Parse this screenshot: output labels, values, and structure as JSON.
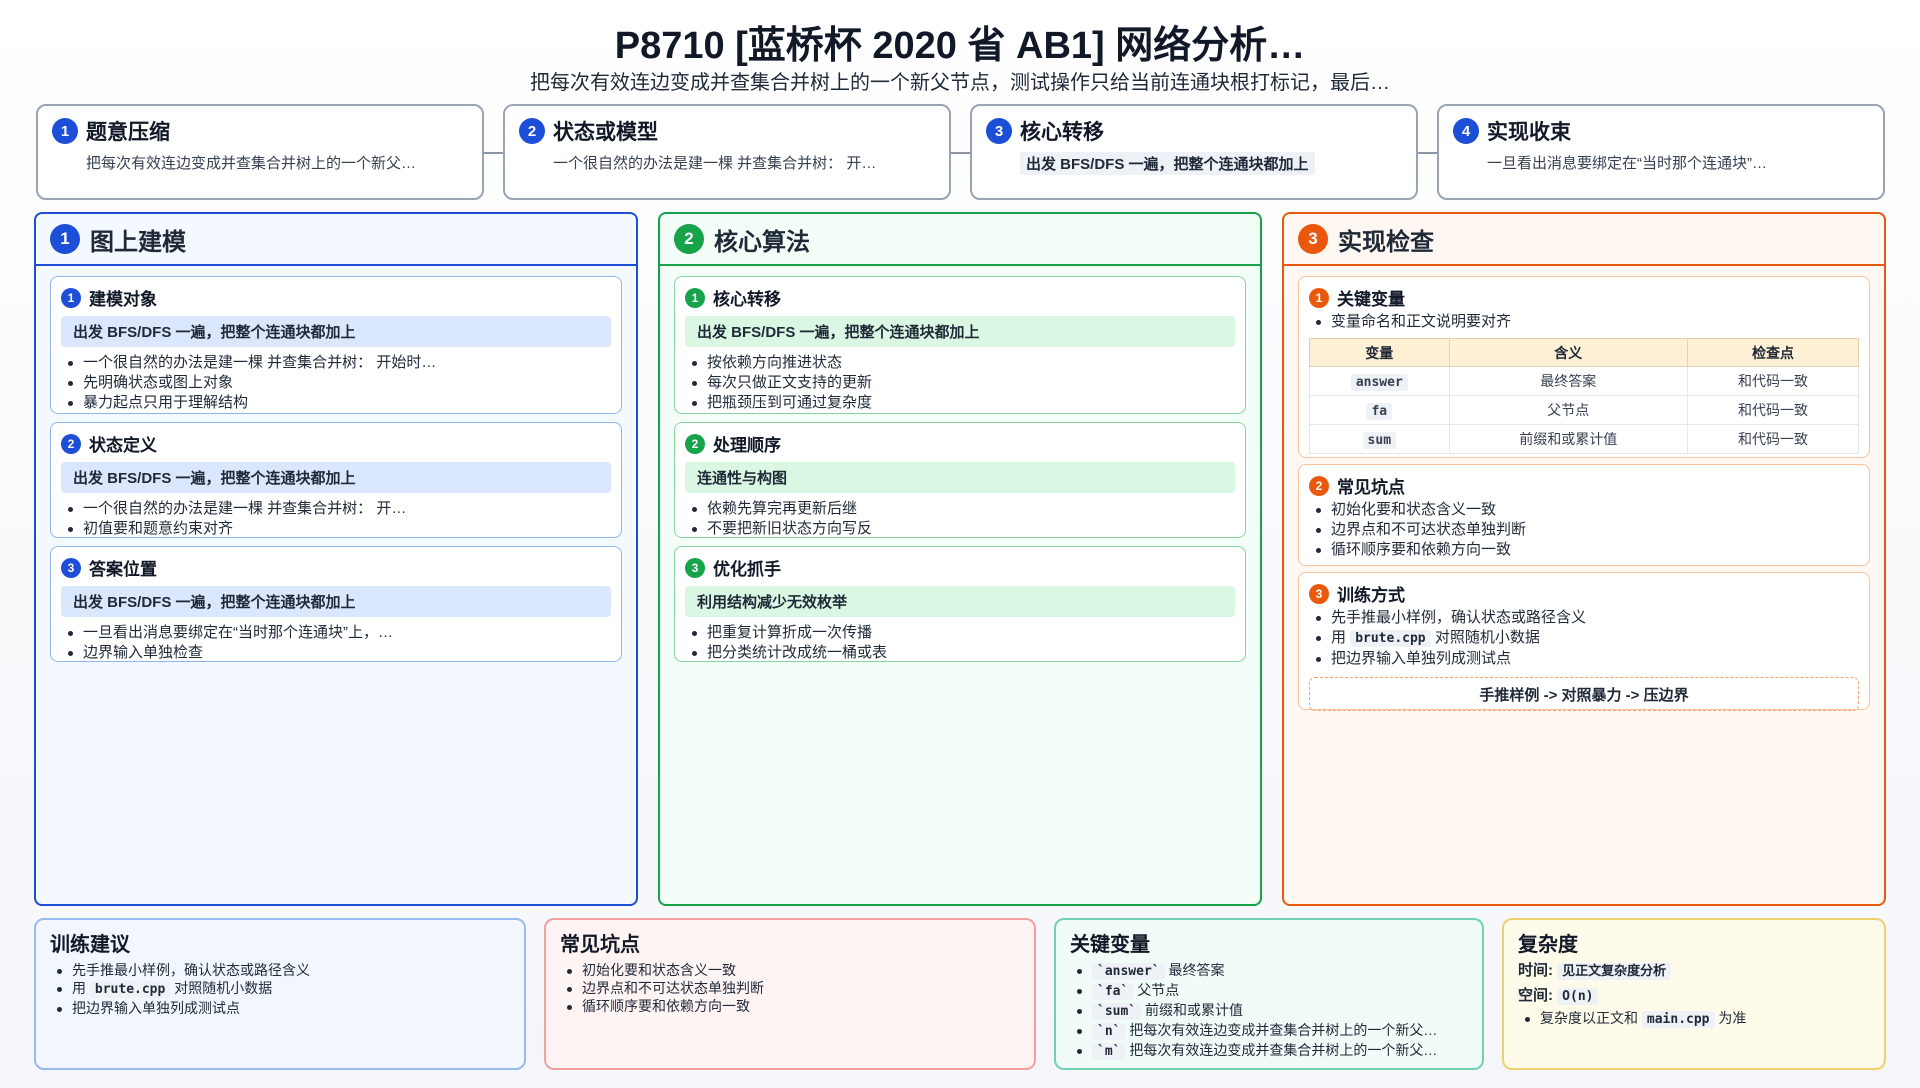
{
  "header": {
    "title": "P8710 [蓝桥杯 2020 省 AB1] 网络分析…",
    "subtitle": "把每次有效连边变成并查集合并树上的一个新父节点，测试操作只给当前连通块根打标记，最后…"
  },
  "steps": [
    {
      "num": "1",
      "title": "题意压缩",
      "body": "把每次有效连边变成并查集合并树上的一个新父…",
      "color": "#1d4ed8"
    },
    {
      "num": "2",
      "title": "状态或模型",
      "body": "一个很自然的办法是建一棵 并查集合并树： 开…",
      "color": "#1d4ed8"
    },
    {
      "num": "3",
      "title": "核心转移",
      "body": "出发 BFS/DFS 一遍，把整个连通块都加上",
      "color": "#1d4ed8"
    },
    {
      "num": "4",
      "title": "实现收束",
      "body": "一旦看出消息要绑定在“当时那个连通块”…",
      "color": "#1d4ed8"
    }
  ],
  "columns": [
    {
      "num": "1",
      "title": "图上建模",
      "color": "#1d4ed8",
      "bg": "#f4f8ff",
      "cards": [
        {
          "num": "1",
          "title": "建模对象",
          "highlight": "出发 BFS/DFS 一遍，把整个连通块都加上",
          "bullets": [
            "一个很自然的办法是建一棵 并查集合并树： 开始时…",
            "先明确状态或图上对象",
            "暴力起点只用于理解结构"
          ]
        },
        {
          "num": "2",
          "title": "状态定义",
          "highlight": "出发 BFS/DFS 一遍，把整个连通块都加上",
          "bullets": [
            "一个很自然的办法是建一棵 并查集合并树： 开…",
            "初值要和题意约束对齐"
          ]
        },
        {
          "num": "3",
          "title": "答案位置",
          "highlight": "出发 BFS/DFS 一遍，把整个连通块都加上",
          "bullets": [
            "一旦看出消息要绑定在“当时那个连通块”上，…",
            "边界输入单独检查"
          ]
        }
      ]
    },
    {
      "num": "2",
      "title": "核心算法",
      "color": "#16a34a",
      "bg": "#f4fdf7",
      "cards": [
        {
          "num": "1",
          "title": "核心转移",
          "highlight": "出发 BFS/DFS 一遍，把整个连通块都加上",
          "bullets": [
            "按依赖方向推进状态",
            "每次只做正文支持的更新",
            "把瓶颈压到可通过复杂度"
          ]
        },
        {
          "num": "2",
          "title": "处理顺序",
          "highlight": "连通性与构图",
          "bullets": [
            "依赖先算完再更新后继",
            "不要把新旧状态方向写反"
          ]
        },
        {
          "num": "3",
          "title": "优化抓手",
          "highlight": "利用结构减少无效枚举",
          "bullets": [
            "把重复计算折成一次传播",
            "把分类统计改成统一桶或表"
          ]
        }
      ]
    },
    {
      "num": "3",
      "title": "实现检查",
      "color": "#ea580c",
      "bg": "#fff8f2",
      "vars": {
        "num": "1",
        "title": "关键变量",
        "note": "变量命名和正文说明要对齐",
        "headers": [
          "变量",
          "含义",
          "检查点"
        ],
        "rows": [
          [
            "answer",
            "最终答案",
            "和代码一致"
          ],
          [
            "fa",
            "父节点",
            "和代码一致"
          ],
          [
            "sum",
            "前缀和或累计值",
            "和代码一致"
          ]
        ]
      },
      "pitfalls": {
        "num": "2",
        "title": "常见坑点",
        "bullets": [
          "初始化要和状态含义一致",
          "边界点和不可达状态单独判断",
          "循环顺序要和依赖方向一致"
        ]
      },
      "train": {
        "num": "3",
        "title": "训练方式",
        "bullets": [
          "先手推最小样例，确认状态或路径含义",
          "把边界输入单独列成测试点"
        ],
        "b2pre": "用",
        "b2code": "brute.cpp",
        "b2post": "对照随机小数据",
        "flow": "手推样例 -> 对照暴力 -> 压边界"
      }
    }
  ],
  "bottom": {
    "advice": {
      "title": "训练建议",
      "b1": "先手推最小样例，确认状态或路径含义",
      "b2pre": "用",
      "b2code": "brute.cpp",
      "b2post": "对照随机小数据",
      "b3": "把边界输入单独列成测试点"
    },
    "pitfalls": {
      "title": "常见坑点",
      "bullets": [
        "初始化要和状态含义一致",
        "边界点和不可达状态单独判断",
        "循环顺序要和依赖方向一致"
      ]
    },
    "vars": {
      "title": "关键变量",
      "items": [
        {
          "code": "`answer`",
          "text": "最终答案"
        },
        {
          "code": "`fa`",
          "text": "父节点"
        },
        {
          "code": "`sum`",
          "text": "前缀和或累计值"
        },
        {
          "code": "`n`",
          "text": "把每次有效连边变成并查集合并树上的一个新父…"
        },
        {
          "code": "`m`",
          "text": "把每次有效连边变成并查集合并树上的一个新父…"
        }
      ]
    },
    "complexity": {
      "title": "复杂度",
      "time_label": "时间:",
      "time_value": "见正文复杂度分析",
      "space_label": "空间:",
      "space_value": "O(n)",
      "note_pre": "复杂度以正文和",
      "note_code": "main.cpp",
      "note_post": "为准"
    }
  }
}
